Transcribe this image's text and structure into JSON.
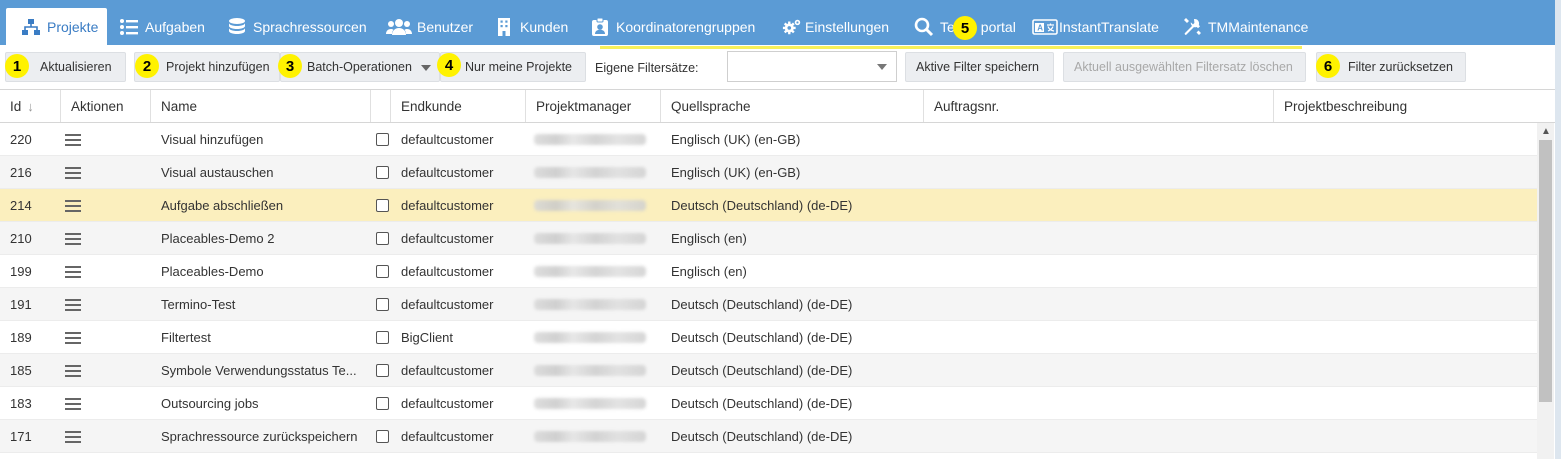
{
  "nav": {
    "tabs": [
      {
        "label": "Projekte",
        "icon": "sitemap-icon",
        "active": true
      },
      {
        "label": "Aufgaben",
        "icon": "list-icon"
      },
      {
        "label": "Sprachressourcen",
        "icon": "database-icon"
      },
      {
        "label": "Benutzer",
        "icon": "users-icon"
      },
      {
        "label": "Kunden",
        "icon": "building-icon"
      },
      {
        "label": "Koordinatorengruppen",
        "icon": "id-badge-icon"
      },
      {
        "label": "Einstellungen",
        "icon": "gears-icon"
      },
      {
        "label": "Te",
        "label2": "portal",
        "icon": "search-icon"
      },
      {
        "label": "InstantTranslate",
        "icon": "translate-icon"
      },
      {
        "label": "TMMaintenance",
        "icon": "tools-icon"
      }
    ]
  },
  "toolbar": {
    "refresh_label": "Aktualisieren",
    "add_project_label": "Projekt hinzufügen",
    "batch_label": "Batch-Operationen",
    "my_projects_label": "Nur meine Projekte",
    "filtersets_label": "Eigene Filtersätze:",
    "filterset_value": "",
    "save_filter_label": "Aktive Filter speichern",
    "delete_filterset_label": "Aktuell ausgewählten Filtersatz löschen",
    "reset_filter_label": "Filter zurücksetzen"
  },
  "badges": [
    "1",
    "2",
    "3",
    "4",
    "5",
    "6"
  ],
  "grid": {
    "columns": [
      "Id",
      "Aktionen",
      "Name",
      "",
      "Endkunde",
      "Projektmanager",
      "Quellsprache",
      "Auftragsnr.",
      "Projektbeschreibung"
    ],
    "rows": [
      {
        "id": "220",
        "name": "Visual hinzufügen",
        "customer": "defaultcustomer",
        "source": "Englisch (UK) (en-GB)"
      },
      {
        "id": "216",
        "name": "Visual austauschen",
        "customer": "defaultcustomer",
        "source": "Englisch (UK) (en-GB)"
      },
      {
        "id": "214",
        "name": "Aufgabe abschließen",
        "customer": "defaultcustomer",
        "source": "Deutsch (Deutschland) (de-DE)",
        "selected": true
      },
      {
        "id": "210",
        "name": "Placeables-Demo 2",
        "customer": "defaultcustomer",
        "source": "Englisch (en)"
      },
      {
        "id": "199",
        "name": "Placeables-Demo",
        "customer": "defaultcustomer",
        "source": "Englisch (en)"
      },
      {
        "id": "191",
        "name": "Termino-Test",
        "customer": "defaultcustomer",
        "source": "Deutsch (Deutschland) (de-DE)"
      },
      {
        "id": "189",
        "name": "Filtertest",
        "customer": "BigClient",
        "source": "Deutsch (Deutschland) (de-DE)"
      },
      {
        "id": "185",
        "name": "Symbole Verwendungsstatus Te...",
        "customer": "defaultcustomer",
        "source": "Deutsch (Deutschland) (de-DE)"
      },
      {
        "id": "183",
        "name": "Outsourcing jobs",
        "customer": "defaultcustomer",
        "source": "Deutsch (Deutschland) (de-DE)"
      },
      {
        "id": "171",
        "name": "Sprachressource zurückspeichern",
        "customer": "defaultcustomer",
        "source": "Deutsch (Deutschland) (de-DE)"
      }
    ]
  },
  "colors": {
    "nav_bg": "#5b9bd5",
    "selected_row": "#fbefbe",
    "badge": "#fff200"
  }
}
